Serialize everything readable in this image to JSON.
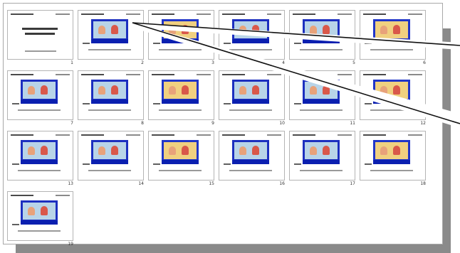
{
  "slides": [
    {
      "number": "1",
      "kind": "title"
    },
    {
      "number": "2",
      "kind": "picture",
      "selected": true
    },
    {
      "number": "3",
      "kind": "picture"
    },
    {
      "number": "4",
      "kind": "picture"
    },
    {
      "number": "5",
      "kind": "picture"
    },
    {
      "number": "6",
      "kind": "picture"
    },
    {
      "number": "7",
      "kind": "picture"
    },
    {
      "number": "8",
      "kind": "picture"
    },
    {
      "number": "9",
      "kind": "picture"
    },
    {
      "number": "10",
      "kind": "picture"
    },
    {
      "number": "11",
      "kind": "picture"
    },
    {
      "number": "12",
      "kind": "picture"
    },
    {
      "number": "13",
      "kind": "picture"
    },
    {
      "number": "14",
      "kind": "picture"
    },
    {
      "number": "15",
      "kind": "picture"
    },
    {
      "number": "16",
      "kind": "picture"
    },
    {
      "number": "17",
      "kind": "picture"
    },
    {
      "number": "18",
      "kind": "picture"
    },
    {
      "number": "19",
      "kind": "picture"
    }
  ],
  "colors": {
    "slide_band": "#1c2fbf",
    "shadow": "#8a8a8a",
    "border": "#a8a8a8"
  }
}
